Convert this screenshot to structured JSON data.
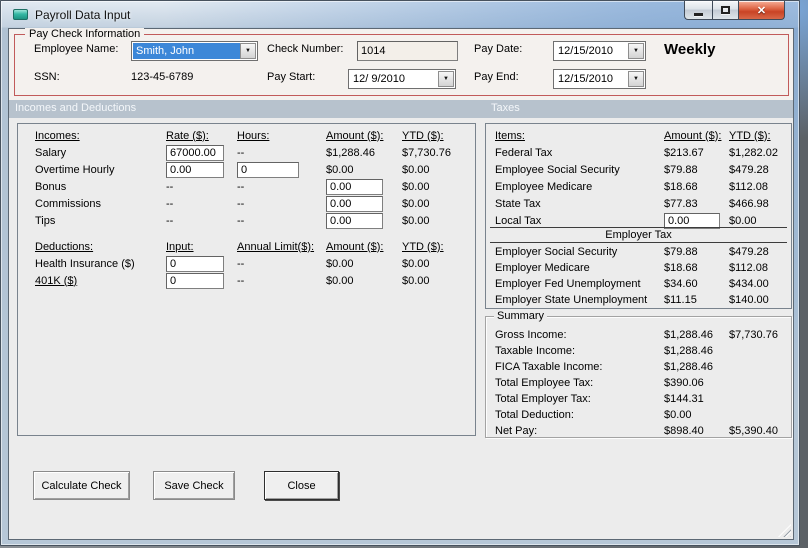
{
  "window": {
    "title": "Payroll Data Input"
  },
  "icons": {
    "dropdown_arrow": "▼",
    "close_glyph": "✕"
  },
  "colors": {
    "groupbox_red": "#c15a5a",
    "band_blue_gray": "#b7c2cd",
    "selection_blue": "#3c87d8",
    "close_button_red": "#c94325"
  },
  "paycheck": {
    "legend": "Pay Check Information",
    "employee_name_label": "Employee Name:",
    "employee_name_value": "Smith, John",
    "ssn_label": "SSN:",
    "ssn_value": "123-45-6789",
    "check_number_label": "Check Number:",
    "check_number_value": "1014",
    "pay_start_label": "Pay Start:",
    "pay_start_value": "12/ 9/2010",
    "pay_date_label": "Pay Date:",
    "pay_date_value": "12/15/2010",
    "pay_end_label": "Pay End:",
    "pay_end_value": "12/15/2010",
    "frequency": "Weekly"
  },
  "bands": {
    "incomes_deductions": "Incomes and Deductions",
    "taxes": "Taxes"
  },
  "incomes": {
    "headers": [
      "Incomes:",
      "Rate ($):",
      "Hours:",
      "Amount ($):",
      "YTD ($):"
    ],
    "rows": [
      {
        "label": "Salary",
        "rate": "67000.00",
        "hours": "--",
        "amount": "$1,288.46",
        "ytd": "$7,730.76"
      },
      {
        "label": "Overtime Hourly",
        "rate": "0.00",
        "hours": "0",
        "amount": "$0.00",
        "ytd": "$0.00"
      },
      {
        "label": "Bonus",
        "rate": "--",
        "hours": "--",
        "amount": "0.00",
        "ytd": "$0.00"
      },
      {
        "label": "Commissions",
        "rate": "--",
        "hours": "--",
        "amount": "0.00",
        "ytd": "$0.00"
      },
      {
        "label": "Tips",
        "rate": "--",
        "hours": "--",
        "amount": "0.00",
        "ytd": "$0.00"
      }
    ]
  },
  "deductions": {
    "headers": [
      "Deductions:",
      "Input:",
      "Annual Limit($):",
      "Amount ($):",
      "YTD ($):"
    ],
    "rows": [
      {
        "label": "Health Insurance  ($)",
        "input": "0",
        "limit": "--",
        "amount": "$0.00",
        "ytd": "$0.00"
      },
      {
        "label": "401K  ($)",
        "input": "0",
        "limit": "--",
        "amount": "$0.00",
        "ytd": "$0.00"
      }
    ]
  },
  "taxes": {
    "headers": [
      "Items:",
      "Amount ($):",
      "YTD ($):"
    ],
    "employee_rows": [
      {
        "label": "Federal Tax",
        "amount": "$213.67",
        "ytd": "$1,282.02"
      },
      {
        "label": "Employee Social Security",
        "amount": "$79.88",
        "ytd": "$479.28"
      },
      {
        "label": "Employee Medicare",
        "amount": "$18.68",
        "ytd": "$112.08"
      },
      {
        "label": "State Tax",
        "amount": "$77.83",
        "ytd": "$466.98"
      },
      {
        "label": "Local Tax",
        "amount": "0.00",
        "ytd": "$0.00"
      }
    ],
    "employer_header": "Employer Tax",
    "employer_rows": [
      {
        "label": "Employer Social Security",
        "amount": "$79.88",
        "ytd": "$479.28"
      },
      {
        "label": "Employer Medicare",
        "amount": "$18.68",
        "ytd": "$112.08"
      },
      {
        "label": "Employer Fed Unemployment",
        "amount": "$34.60",
        "ytd": "$434.00"
      },
      {
        "label": "Employer State Unemployment",
        "amount": "$11.15",
        "ytd": "$140.00"
      }
    ]
  },
  "summary": {
    "legend": "Summary",
    "rows": [
      {
        "label": "Gross Income:",
        "amount": "$1,288.46",
        "ytd": "$7,730.76"
      },
      {
        "label": "Taxable Income:",
        "amount": "$1,288.46",
        "ytd": ""
      },
      {
        "label": "FICA Taxable Income:",
        "amount": "$1,288.46",
        "ytd": ""
      },
      {
        "label": "Total Employee Tax:",
        "amount": "$390.06",
        "ytd": ""
      },
      {
        "label": "Total Employer Tax:",
        "amount": "$144.31",
        "ytd": ""
      },
      {
        "label": "Total Deduction:",
        "amount": "$0.00",
        "ytd": ""
      },
      {
        "label": "Net Pay:",
        "amount": "$898.40",
        "ytd": "$5,390.40"
      }
    ]
  },
  "buttons": {
    "calculate": "Calculate Check",
    "save": "Save Check",
    "close": "Close"
  }
}
